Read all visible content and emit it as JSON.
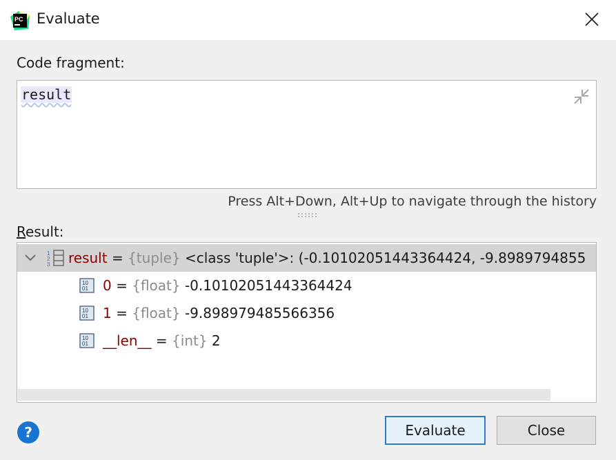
{
  "window": {
    "title": "Evaluate",
    "app_icon": "pycharm-icon",
    "close_icon": "close-icon"
  },
  "code": {
    "label": "Code fragment:",
    "value": "result"
  },
  "hint": "Press Alt+Down, Alt+Up to navigate through the history",
  "result": {
    "label_mnemonic": "R",
    "label_rest": "esult:",
    "rows": [
      {
        "name": "result",
        "eq": " = ",
        "type": "{tuple}",
        "value": " <class 'tuple'>: (-0.10102051443364424, -9.8989794855"
      },
      {
        "name": "0",
        "eq": " = ",
        "type": "{float}",
        "value": " -0.10102051443364424"
      },
      {
        "name": "1",
        "eq": " = ",
        "type": "{float}",
        "value": " -9.898979485566356"
      },
      {
        "name": "__len__",
        "eq": " = ",
        "type": "{int}",
        "value": " 2"
      }
    ]
  },
  "buttons": {
    "help": "?",
    "evaluate": "Evaluate",
    "close": "Close"
  },
  "colors": {
    "accent": "#2f7bd1",
    "help_blue": "#1874d3",
    "var_name": "#8b0000",
    "type_gray": "#8c8c8c",
    "selected_row": "#d4d4d4"
  }
}
